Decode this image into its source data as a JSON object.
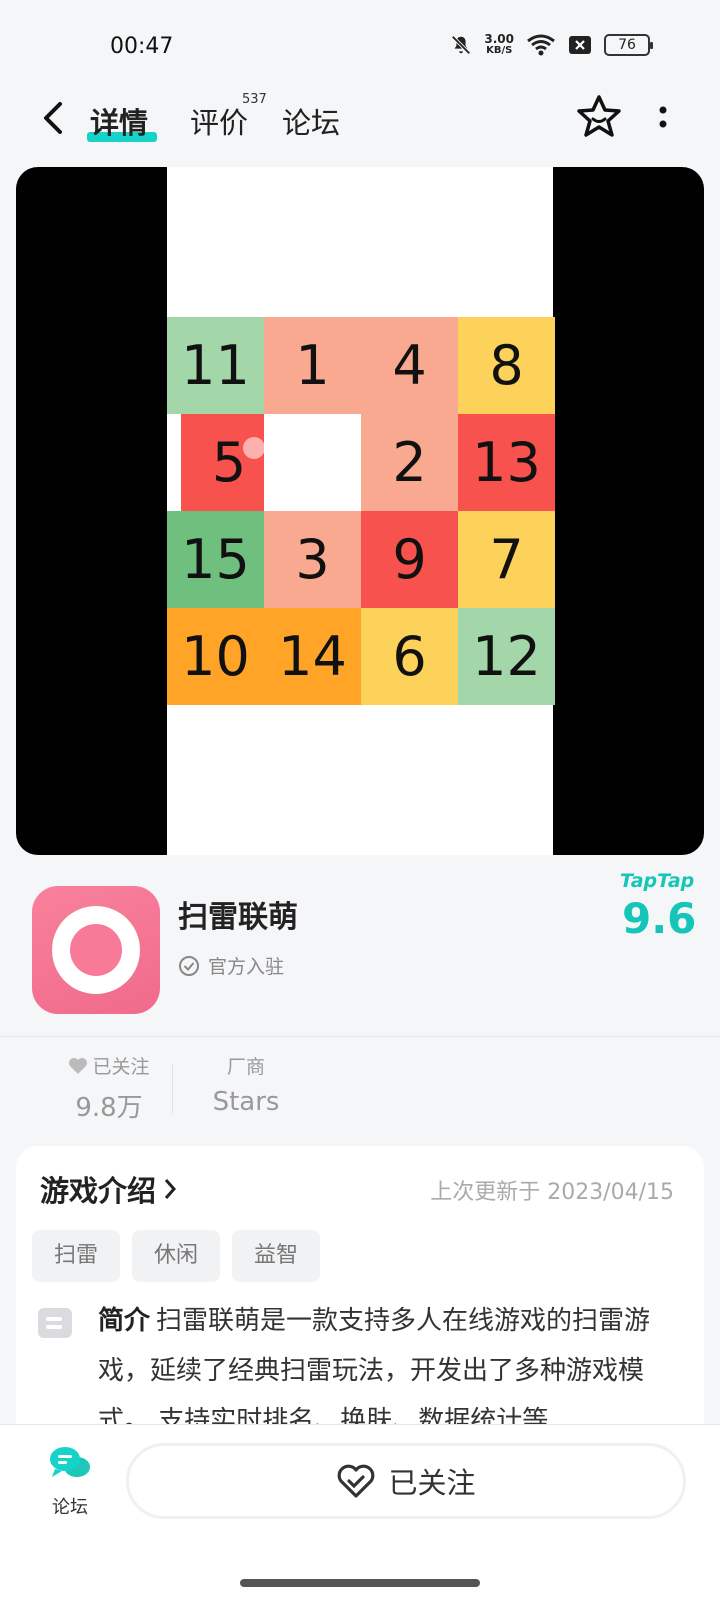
{
  "status_bar": {
    "time": "00:47",
    "speed_value": "3.00",
    "speed_unit": "KB/S",
    "battery": "76"
  },
  "nav": {
    "tab_detail": "详情",
    "tab_review": "评价",
    "review_count": "537",
    "tab_forum": "论坛"
  },
  "puzzle": {
    "cells": [
      {
        "n": "11",
        "color": "#a3d6a8"
      },
      {
        "n": "1",
        "color": "#f9a98f"
      },
      {
        "n": "4",
        "color": "#f9a98f"
      },
      {
        "n": "8",
        "color": "#fdd25a"
      },
      {
        "n": "5",
        "color": "#f8524f"
      },
      {
        "n": "",
        "color": "#ffffff"
      },
      {
        "n": "2",
        "color": "#f9a98f"
      },
      {
        "n": "13",
        "color": "#f8524f"
      },
      {
        "n": "15",
        "color": "#6fc07f"
      },
      {
        "n": "3",
        "color": "#f9a98f"
      },
      {
        "n": "9",
        "color": "#f8524f"
      },
      {
        "n": "7",
        "color": "#fdd25a"
      },
      {
        "n": "10",
        "color": "#ffa427"
      },
      {
        "n": "14",
        "color": "#ffa427"
      },
      {
        "n": "6",
        "color": "#fdd25a"
      },
      {
        "n": "12",
        "color": "#a3d6a8"
      }
    ]
  },
  "app": {
    "name": "扫雷联萌",
    "verified": "官方入驻",
    "brand": "TapTap",
    "score": "9.6"
  },
  "stats": {
    "follow_label": "已关注",
    "follow_value": "9.8万",
    "vendor_label": "厂商",
    "vendor_value": "Stars"
  },
  "intro": {
    "title": "游戏介绍",
    "updated": "上次更新于 2023/04/15",
    "tags": [
      "扫雷",
      "休闲",
      "益智"
    ],
    "summary_head": "简介",
    "summary": "扫雷联萌是一款支持多人在线游戏的扫雷游戏，延续了经典扫雷玩法，开发出了多种游戏模式。 支持实时排名、换肤、数据统计等..."
  },
  "bottom": {
    "forum_label": "论坛",
    "follow_button": "已关注"
  },
  "colors": {
    "accent": "#15d3c8",
    "app_icon": "#f06a8c"
  }
}
